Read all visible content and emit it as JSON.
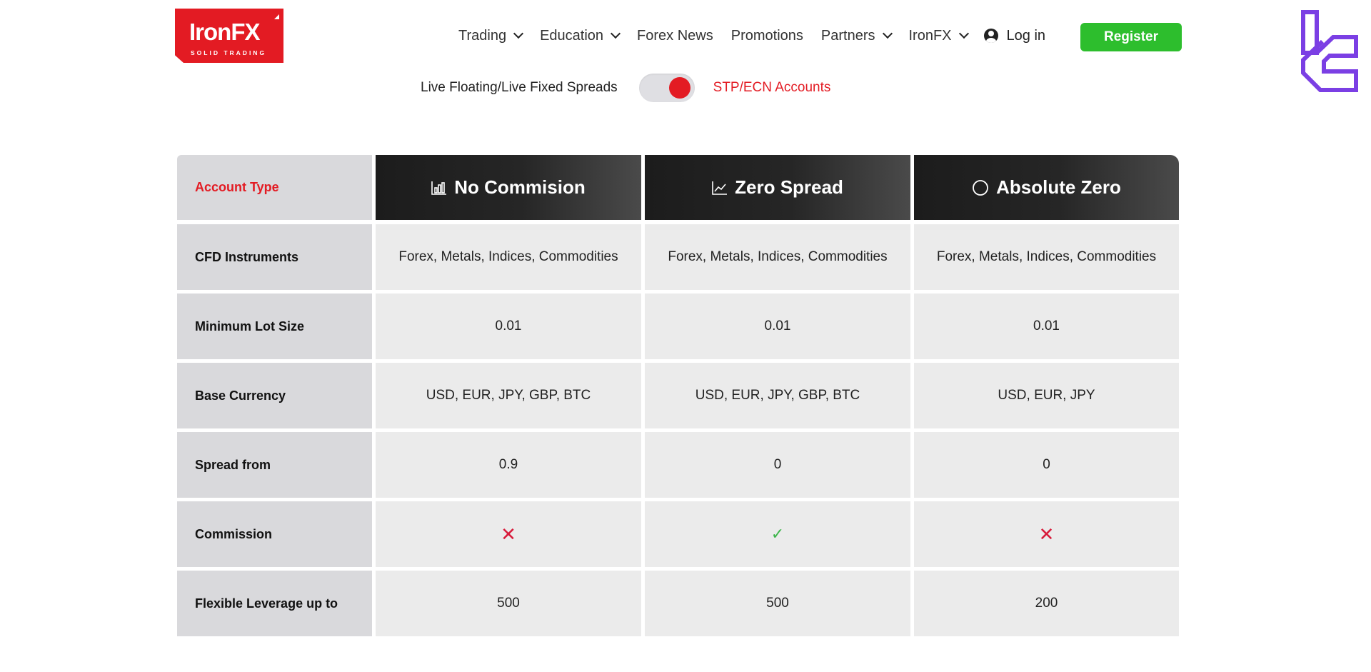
{
  "logo": {
    "brand": "IronFX",
    "tagline": "SOLID TRADING"
  },
  "nav": {
    "items": [
      {
        "label": "Trading",
        "has_dropdown": true
      },
      {
        "label": "Education",
        "has_dropdown": true
      },
      {
        "label": "Forex News",
        "has_dropdown": false
      },
      {
        "label": "Promotions",
        "has_dropdown": false
      },
      {
        "label": "Partners",
        "has_dropdown": true
      },
      {
        "label": "IronFX",
        "has_dropdown": true
      }
    ],
    "login_label": "Log in",
    "register_label": "Register"
  },
  "toggle": {
    "left_label": "Live Floating/Live Fixed Spreads",
    "right_label": "STP/ECN Accounts",
    "state": "right"
  },
  "colors": {
    "accent_red": "#e31b23",
    "register_green": "#2dbe2d",
    "brand_mark_purple": "#7b3fe4",
    "check_green": "#3cb54a",
    "cross_red": "#d81b3b"
  },
  "table": {
    "header_label": "Account Type",
    "accounts": [
      {
        "name": "No Commision",
        "icon": "bar-chart-icon"
      },
      {
        "name": "Zero Spread",
        "icon": "line-chart-icon"
      },
      {
        "name": "Absolute Zero",
        "icon": "circle-icon"
      }
    ],
    "rows": [
      {
        "label": "CFD Instruments",
        "values": [
          "Forex, Metals, Indices, Commodities",
          "Forex, Metals, Indices, Commodities",
          "Forex, Metals, Indices, Commodities"
        ]
      },
      {
        "label": "Minimum Lot Size",
        "values": [
          "0.01",
          "0.01",
          "0.01"
        ]
      },
      {
        "label": "Base Currency",
        "values": [
          "USD, EUR, JPY, GBP, BTC",
          "USD, EUR, JPY, GBP, BTC",
          "USD, EUR, JPY"
        ]
      },
      {
        "label": "Spread from",
        "values": [
          "0.9",
          "0",
          "0"
        ]
      },
      {
        "label": "Commission",
        "values": [
          "✕",
          "✓",
          "✕"
        ]
      },
      {
        "label": "Flexible Leverage up to",
        "values": [
          "500",
          "500",
          "200"
        ]
      }
    ]
  }
}
